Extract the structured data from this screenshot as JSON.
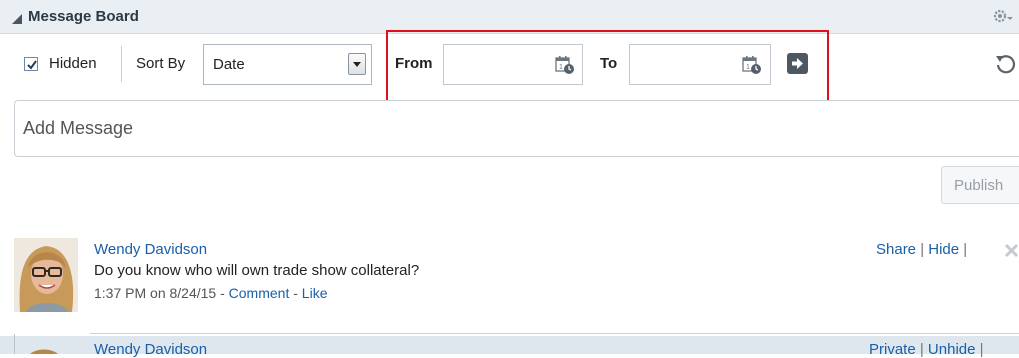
{
  "header": {
    "title": "Message Board"
  },
  "toolbar": {
    "hidden_label": "Hidden",
    "hidden_checked": true,
    "sort_by_label": "Sort By",
    "sort_value": "Date",
    "from_label": "From",
    "from_value": "",
    "to_label": "To",
    "to_value": ""
  },
  "compose": {
    "placeholder": "Add Message",
    "publish_label": "Publish"
  },
  "posts": [
    {
      "author": "Wendy Davidson",
      "text": "Do you know who will own trade show collateral?",
      "time": "1:37 PM on 8/24/15",
      "dash1": " - ",
      "comment": "Comment",
      "dash2": " - ",
      "like": "Like",
      "share": "Share",
      "sep1": " | ",
      "hide": "Hide",
      "sep2": " | "
    },
    {
      "author": "Wendy Davidson",
      "private": "Private",
      "sep1": " | ",
      "unhide": "Unhide",
      "sep2": " | "
    }
  ],
  "colors": {
    "accent": "#1a5fa8",
    "highlight": "#e10f1b",
    "header_bg": "#e9eff3"
  },
  "icons": [
    "collapse-triangle-icon",
    "gear-icon",
    "checkbox-check-icon",
    "dropdown-arrow-icon",
    "calendar-icon",
    "go-arrow-icon",
    "refresh-icon",
    "delete-x-icon"
  ]
}
